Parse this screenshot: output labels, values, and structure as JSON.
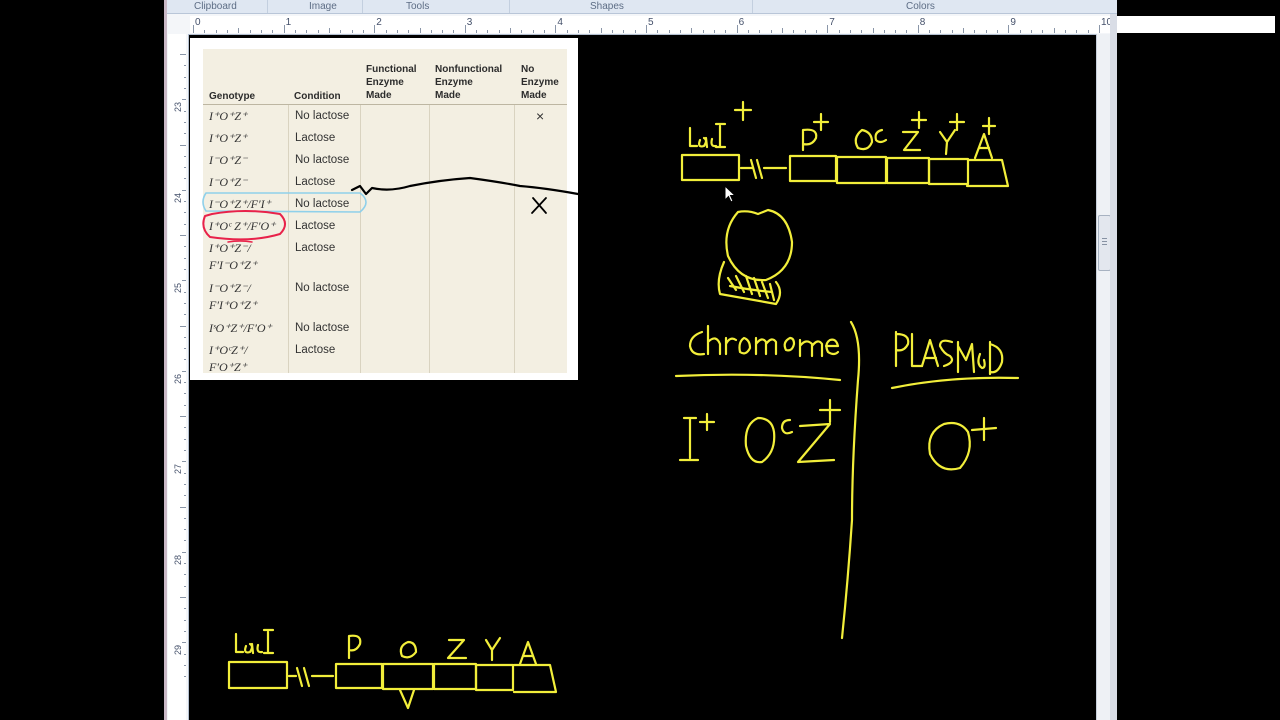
{
  "ribbon": {
    "groups": [
      "Clipboard",
      "Image",
      "Tools",
      "Shapes",
      "Colors"
    ]
  },
  "ruler": {
    "top_numbers": [
      "0",
      "1",
      "2",
      "3",
      "4",
      "5",
      "6",
      "7",
      "8",
      "9",
      "10"
    ],
    "left_numbers": [
      "23",
      "24",
      "25",
      "26",
      "27",
      "28",
      "29"
    ]
  },
  "table": {
    "headers": {
      "genotype": "Genotype",
      "condition": "Condition",
      "functional": [
        "Functional",
        "Enzyme",
        "Made"
      ],
      "nonfunctional": [
        "Nonfunctional",
        "Enzyme",
        "Made"
      ],
      "none": [
        "No",
        "Enzyme",
        "Made"
      ]
    },
    "rows": [
      {
        "genotype": [
          "I⁺O⁺Z⁺"
        ],
        "condition": "No lactose",
        "no_enzyme": "×"
      },
      {
        "genotype": [
          "I⁺O⁺Z⁺"
        ],
        "condition": "Lactose",
        "no_enzyme": ""
      },
      {
        "genotype": [
          "I⁻O⁺Z⁻"
        ],
        "condition": "No lactose",
        "no_enzyme": ""
      },
      {
        "genotype": [
          "I⁻O⁺Z⁻"
        ],
        "condition": "Lactose",
        "no_enzyme": ""
      },
      {
        "genotype": [
          "I⁻O⁺Z⁺/F′I⁺"
        ],
        "condition": "No lactose",
        "no_enzyme": ""
      },
      {
        "genotype": [
          "I⁺Oᶜ Z⁺/F′O⁺"
        ],
        "condition": "Lactose",
        "no_enzyme": ""
      },
      {
        "genotype": [
          "I⁺O⁺Z⁻/",
          "F′I⁻O⁺Z⁺"
        ],
        "condition": "Lactose",
        "no_enzyme": ""
      },
      {
        "genotype": [
          "I⁻O⁺Z⁻/",
          "F′I⁺O⁺Z⁺"
        ],
        "condition": "No lactose",
        "no_enzyme": ""
      },
      {
        "genotype": [
          "IˢO⁺Z⁺/F′O⁺"
        ],
        "condition": "No lactose",
        "no_enzyme": ""
      },
      {
        "genotype": [
          "I⁺OᶜZ⁺/",
          "F′O⁺Z⁺"
        ],
        "condition": "Lactose",
        "no_enzyme": ""
      }
    ]
  },
  "handwriting": {
    "gene_top": [
      "lacI",
      "+",
      "P",
      "+",
      "O",
      "c",
      "Z",
      "+",
      "Y",
      "+",
      "A",
      "+"
    ],
    "chromosome_label": "Chromosome",
    "plasmid_label": "PlasmiD",
    "chromosome_genotype": "I⁺ Oᶜ Z⁺",
    "plasmid_genotype": "O⁺",
    "gene_bottom": [
      "lacI",
      "P",
      "O",
      "Z",
      "Y",
      "A"
    ],
    "table_mark": "X"
  },
  "colors": {
    "ink_yellow": "#f2ee3a",
    "ink_black": "#000000",
    "highlight_blue": "#8fd0ea",
    "highlight_red": "#e8224a",
    "canvas": "#000000",
    "ribbon_bg": "#dfe7f2"
  }
}
